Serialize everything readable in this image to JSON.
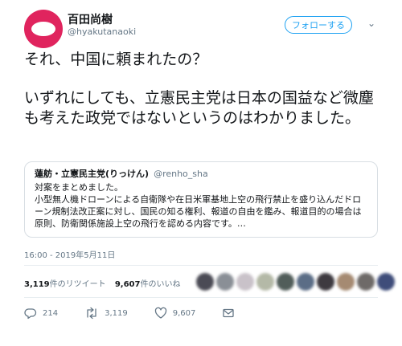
{
  "author": {
    "display_name": "百田尚樹",
    "handle": "@hyakutanaoki"
  },
  "follow_button": "フォローする",
  "tweet": {
    "line1": "それ、中国に頼まれたの？",
    "line2": "いずれにしても、立憲民主党は日本の国益など微塵も考えた政党ではないというのはわかりました。"
  },
  "quoted_tweet": {
    "name": "蓮舫・立憲民主党(りっけん)",
    "handle": "@renho_sha",
    "line1": "対案をまとめました。",
    "body": "小型無人機ドローンによる自衛隊や在日米軍基地上空の飛行禁止を盛り込んだドローン規制法改正案に対し、国民の知る権利、報道の自由を鑑み、報道目的の場合は原則、防衛関係施設上空の飛行を認める内容です。…"
  },
  "timestamp": "16:00 - 2019年5月11日",
  "stats": {
    "retweets_count": "3,119",
    "retweets_label": "件のリツイート",
    "likes_count": "9,607",
    "likes_label": "件のいいね"
  },
  "liker_colors": [
    "#4b4b55",
    "#8a8f96",
    "#c9c2c9",
    "#b4b9a7",
    "#515d5a",
    "#5b6d86",
    "#3e3a40",
    "#a58a72",
    "#6e6a68",
    "#3f4d7a"
  ],
  "actions": {
    "reply_count": "214",
    "retweet_count": "3,119",
    "like_count": "9,607"
  },
  "icons": [
    "reply-icon",
    "retweet-icon",
    "like-icon",
    "dm-icon",
    "chevron-down-icon"
  ],
  "colors": {
    "accent": "#1da1f2",
    "avatar": "#e0245e",
    "secondary_text": "#657786"
  }
}
